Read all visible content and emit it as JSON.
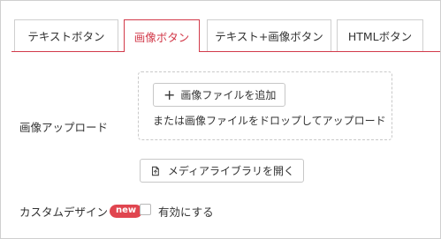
{
  "tabs": [
    {
      "label": "テキストボタン",
      "active": false
    },
    {
      "label": "画像ボタン",
      "active": true
    },
    {
      "label": "テキスト+画像ボタン",
      "active": false
    },
    {
      "label": "HTMLボタン",
      "active": false
    }
  ],
  "upload": {
    "label": "画像アップロード",
    "add_button_icon": "+",
    "add_button_label": "画像ファイルを追加",
    "drop_hint": "または画像ファイルをドロップしてアップロード"
  },
  "media": {
    "button_icon": "document-icon",
    "button_label": "メディアライブラリを開く"
  },
  "custom_design": {
    "label": "カスタムデザイン",
    "badge": "new",
    "checkbox_label": "有効にする",
    "checked": false
  },
  "colors": {
    "accent": "#d23a4a",
    "badge_bg": "#e0454f",
    "border": "#cfcfcf"
  }
}
